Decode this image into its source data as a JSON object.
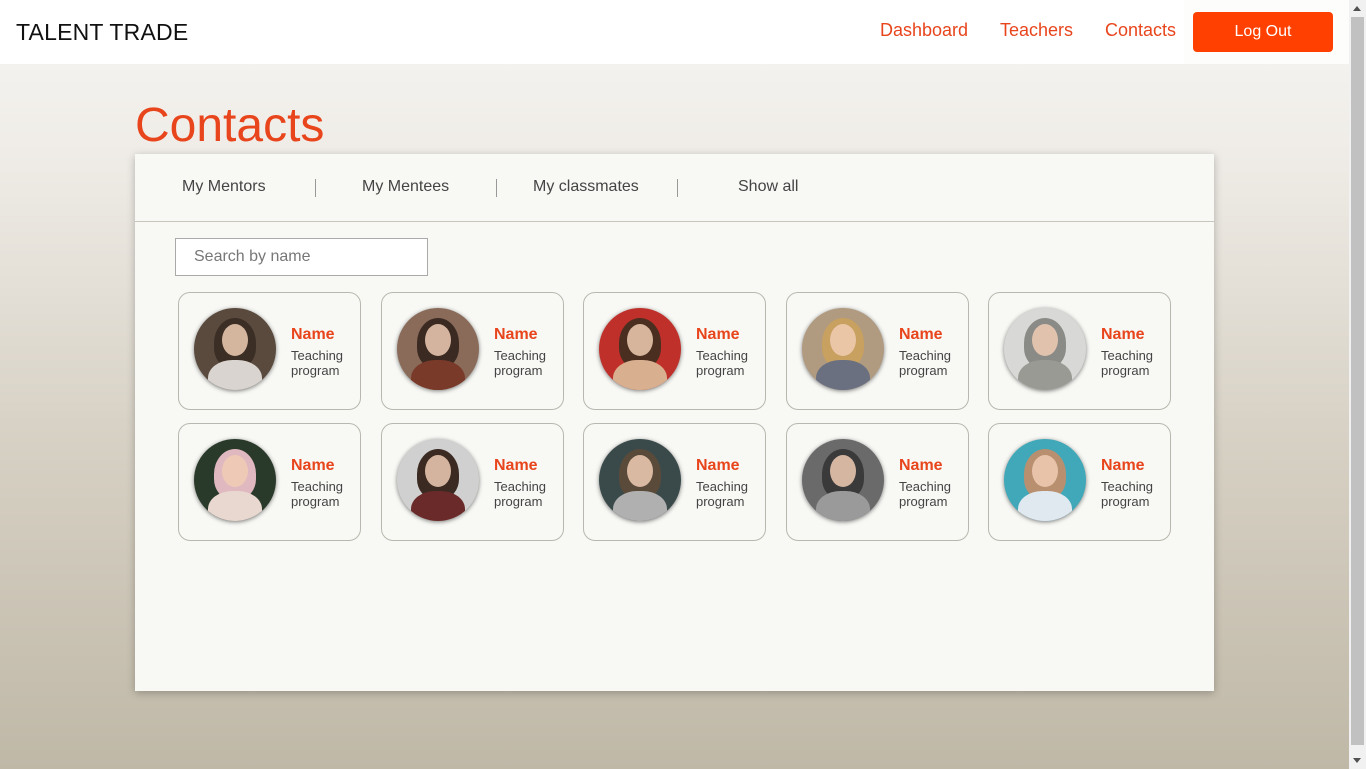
{
  "header": {
    "brand": "TALENT TRADE",
    "nav": [
      "Dashboard",
      "Teachers",
      "Contacts"
    ],
    "logout": "Log Out"
  },
  "page": {
    "title": "Contacts"
  },
  "tabs": [
    "My Mentors",
    "My Mentees",
    "My classmates",
    "Show all"
  ],
  "search": {
    "placeholder": "Search by name",
    "value": ""
  },
  "contacts": [
    {
      "name": "Name",
      "program": "Teaching program"
    },
    {
      "name": "Name",
      "program": "Teaching program"
    },
    {
      "name": "Name",
      "program": "Teaching program"
    },
    {
      "name": "Name",
      "program": "Teaching program"
    },
    {
      "name": "Name",
      "program": "Teaching program"
    },
    {
      "name": "Name",
      "program": "Teaching program"
    },
    {
      "name": "Name",
      "program": "Teaching program"
    },
    {
      "name": "Name",
      "program": "Teaching program"
    },
    {
      "name": "Name",
      "program": "Teaching program"
    },
    {
      "name": "Name",
      "program": "Teaching program"
    }
  ],
  "colors": {
    "accent": "#e8451c",
    "button": "#ff4000",
    "panel": "#f8f8f5"
  }
}
